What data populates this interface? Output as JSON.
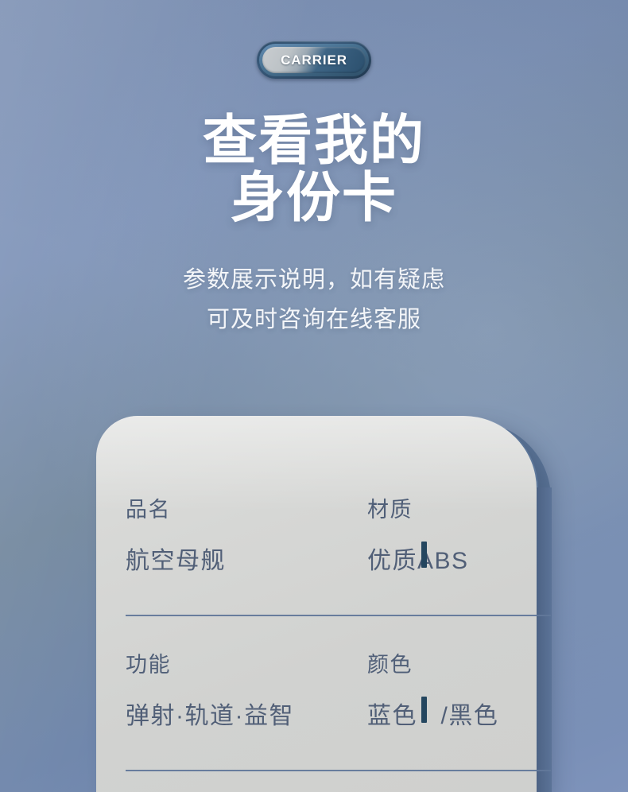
{
  "background": {
    "gradient_from": "#8397ba",
    "gradient_mid": "#74899f",
    "gradient_to": "#7e93bb"
  },
  "badge": {
    "label": "CARRIER",
    "outer_color": "#2d4b68",
    "ring_color": "#648db3",
    "text_color": "#ffffff"
  },
  "headline": {
    "line1": "查看我的",
    "line2": "身份卡",
    "color": "#ffffff"
  },
  "subtitle": {
    "line1": "参数展示说明，如有疑虑",
    "line2": "可及时咨询在线客服",
    "color": "#f4f6f9"
  },
  "spec_card": {
    "surface_color": "#d4d5d3",
    "label_color": "#505f78",
    "value_color": "#515f77",
    "divider_color": "#62789a",
    "tick_color": "#24465f",
    "rows": [
      {
        "left": {
          "label": "品名",
          "value": "航空母舰"
        },
        "right": {
          "label": "材质",
          "value": "优质ABS"
        }
      },
      {
        "left": {
          "label": "功能",
          "value": "弹射·轨道·益智"
        },
        "right": {
          "label": "颜色",
          "value": "蓝色   /黑色"
        }
      }
    ]
  }
}
